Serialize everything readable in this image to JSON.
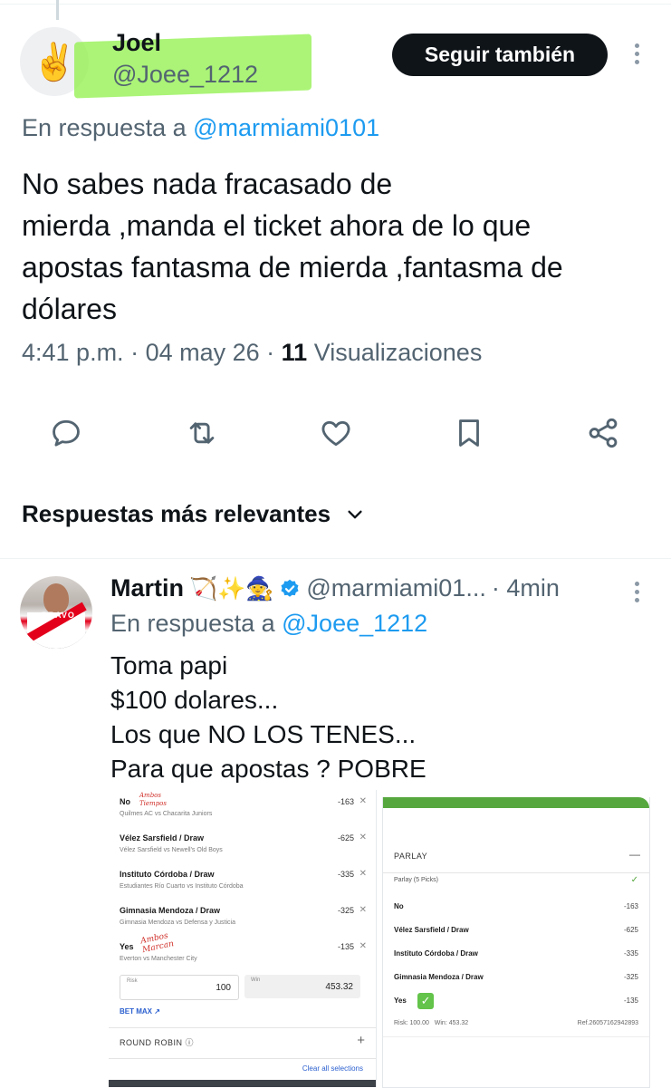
{
  "main_tweet": {
    "author_name": "Joel",
    "author_handle": "@Joee_1212",
    "avatar_emoji": "✌️",
    "follow_label": "Seguir también",
    "reply_prefix": "En respuesta a",
    "reply_to": "@marmiami0101",
    "text_lines": [
      "No sabes nada fracasado de",
      "mierda ,manda el ticket ahora de lo que",
      "apostas fantasma de mierda ,fantasma de",
      "dólares"
    ],
    "time": "4:41 p.m.",
    "date": "04 may 26",
    "views_count": "11",
    "views_label": "Visualizaciones",
    "highlight_color": "#8ff04a"
  },
  "actions": [
    "reply-icon",
    "retweet-icon",
    "like-icon",
    "bookmark-icon",
    "share-icon"
  ],
  "replies_sort": {
    "label": "Respuestas más relevantes"
  },
  "reply_tweet": {
    "author_name": "Martin",
    "author_emojis": "🏹✨🧙",
    "author_handle": "@marmiami01...",
    "time_ago": "· 4min",
    "reply_prefix": "En respuesta a",
    "reply_to": "@Joee_1212",
    "text_lines": [
      "Toma papi",
      "$100 dolares...",
      "Los que NO LOS TENES...",
      "Para que apostas ? POBRE"
    ],
    "avatar_text": "BRAVO"
  },
  "ticket_left": {
    "picks": [
      {
        "name": "No",
        "sub": "Quilmes AC vs Chacarita Juniors",
        "odds": "-163"
      },
      {
        "name": "Vélez Sarsfield / Draw",
        "sub": "Vélez Sarsfield vs Newell's Old Boys",
        "odds": "-625"
      },
      {
        "name": "Instituto Córdoba / Draw",
        "sub": "Estudiantes Río Cuarto vs Instituto Córdoba",
        "odds": "-335"
      },
      {
        "name": "Gimnasia Mendoza / Draw",
        "sub": "Gimnasia Mendoza vs Defensa y Justicia",
        "odds": "-325"
      },
      {
        "name": "Yes",
        "sub": "Everton vs Manchester City",
        "odds": "-135"
      }
    ],
    "scribble_1": "Ambos Tiempos",
    "scribble_2": "Ambos Marcan",
    "risk_label": "Risk",
    "risk_value": "100",
    "win_label": "Win",
    "win_value": "453.32",
    "bet_max": "BET MAX ↗",
    "round_robin": "ROUND ROBIN ⓘ",
    "clear": "Clear all selections"
  },
  "ticket_right": {
    "title": "PARLAY",
    "subtitle": "Parlay (5 Picks)",
    "rows": [
      {
        "name": "No",
        "odds": "-163"
      },
      {
        "name": "Vélez Sarsfield / Draw",
        "odds": "-625"
      },
      {
        "name": "Instituto Córdoba / Draw",
        "odds": "-335"
      },
      {
        "name": "Gimnasia Mendoza / Draw",
        "odds": "-325"
      },
      {
        "name": "Yes",
        "odds": "-135"
      }
    ],
    "footer_risk": "Risk: 100.00",
    "footer_win": "Win: 453.32",
    "footer_ref": "Ref.260571629428​93"
  }
}
